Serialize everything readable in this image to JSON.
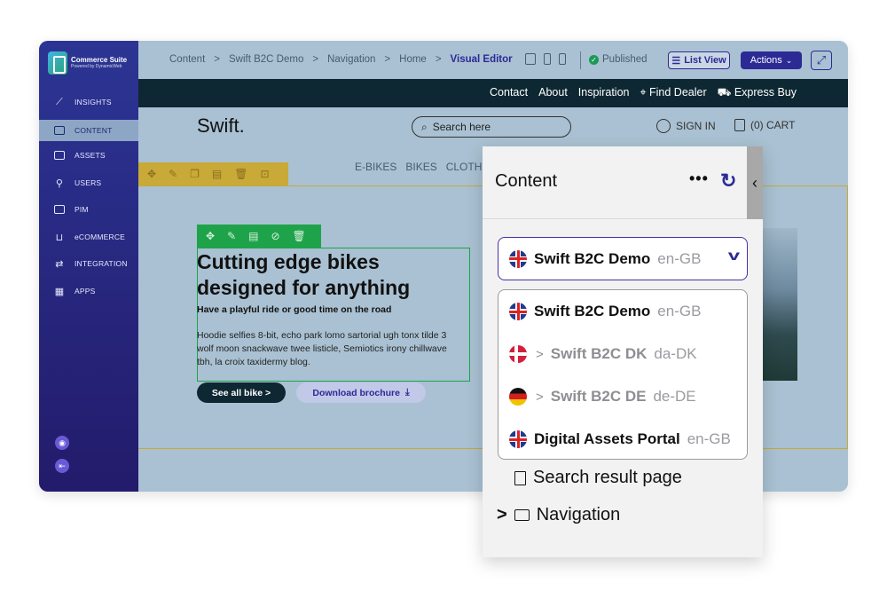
{
  "brand": {
    "title": "Commerce Suite",
    "subtitle": "Powered by DynamicWeb"
  },
  "sidebar": {
    "items": [
      {
        "label": "INSIGHTS",
        "icon": "chart-icon"
      },
      {
        "label": "CONTENT",
        "icon": "monitor-icon",
        "active": true
      },
      {
        "label": "ASSETS",
        "icon": "folder-icon"
      },
      {
        "label": "USERS",
        "icon": "user-icon"
      },
      {
        "label": "PIM",
        "icon": "info-icon"
      },
      {
        "label": "eCOMMERCE",
        "icon": "cart-icon"
      },
      {
        "label": "INTEGRATION",
        "icon": "arrows-icon"
      },
      {
        "label": "APPS",
        "icon": "grid-icon"
      }
    ]
  },
  "topbar": {
    "breadcrumbs": [
      "Content",
      "Swift B2C Demo",
      "Navigation",
      "Home",
      "Visual Editor"
    ],
    "separator": ">",
    "status": "Published",
    "list_view_label": "List View",
    "actions_label": "Actions"
  },
  "site": {
    "top_links": [
      "Contact",
      "About",
      "Inspiration",
      "Find Dealer",
      "Express Buy"
    ],
    "logo": "Swift.",
    "search_placeholder": "Search here",
    "signin": "SIGN IN",
    "cart": "(0) CART",
    "menu": [
      "E-BIKES",
      "BIKES",
      "CLOTHI"
    ]
  },
  "hero": {
    "title": "Cutting edge bikes designed for anything",
    "subtitle": "Have a playful ride or good time on the road",
    "body": "Hoodie selfies 8-bit, echo park lomo sartorial ugh tonx tilde 3 wolf moon snackwave twee listicle, Semiotics irony chillwave tbh, la croix taxidermy blog.",
    "primary_button": "See all bike >",
    "secondary_button": "Download brochure"
  },
  "panel": {
    "title": "Content",
    "more": "•••",
    "selected": {
      "name": "Swift B2C Demo",
      "lang": "en-GB"
    },
    "options": [
      {
        "prefix": "",
        "name": "Swift B2C Demo",
        "lang": "en-GB",
        "flag": "uk"
      },
      {
        "prefix": ">",
        "name": "Swift B2C DK",
        "lang": "da-DK",
        "flag": "dk"
      },
      {
        "prefix": ">",
        "name": "Swift B2C DE",
        "lang": "de-DE",
        "flag": "de"
      },
      {
        "prefix": "",
        "name": "Digital Assets Portal",
        "lang": "en-GB",
        "flag": "uk"
      }
    ],
    "tree": [
      {
        "label": "Search result page",
        "icon": "document-icon"
      },
      {
        "label": "Navigation",
        "icon": "folder-icon",
        "expander": ">"
      }
    ]
  },
  "colors": {
    "accent": "#2c2a95",
    "sidebar": "#2c3594",
    "published": "#1a9a55",
    "row_frame": "#c9a937",
    "element_frame": "#1fa34a"
  }
}
